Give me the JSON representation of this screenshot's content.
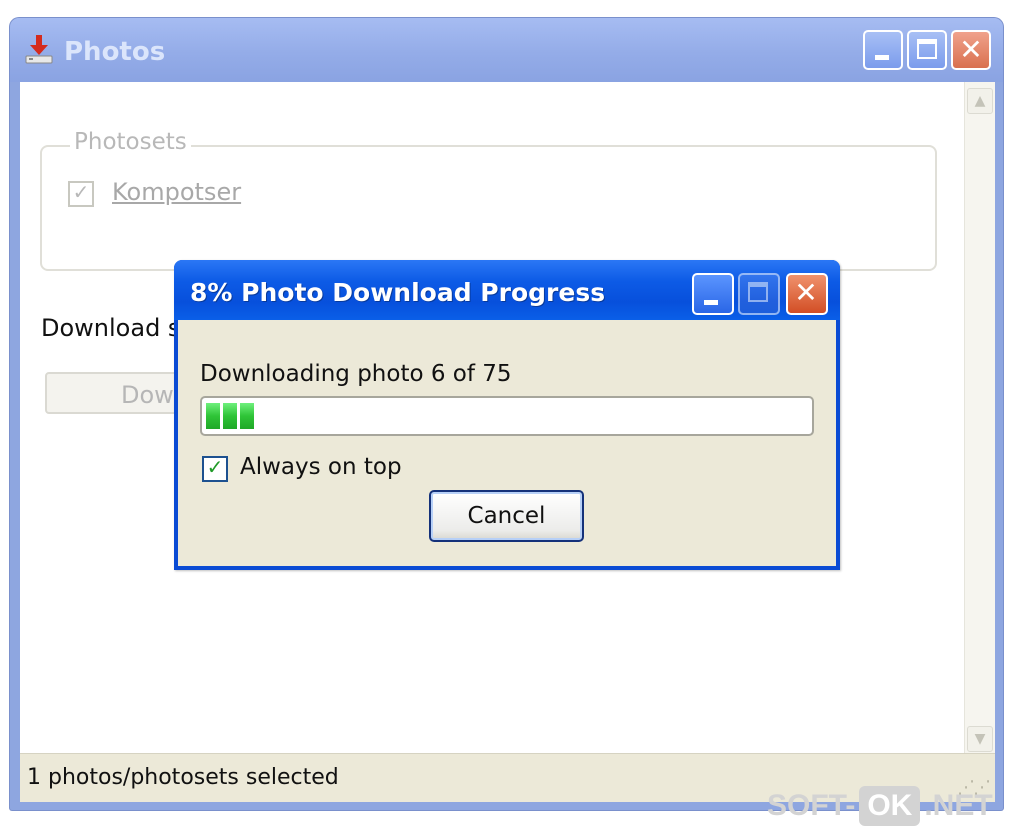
{
  "main_window": {
    "title": "Photos",
    "groupbox_title": "Photosets",
    "photosets": [
      {
        "label": "Kompotser",
        "checked": true
      }
    ],
    "download_label": "Download s",
    "download_button": "Dow",
    "status_text": "1 photos/photosets selected"
  },
  "progress_dialog": {
    "title": "8% Photo Download Progress",
    "status": "Downloading photo 6 of 75",
    "progress_fraction": 0.08,
    "always_on_top_label": "Always on top",
    "always_on_top_checked": true,
    "cancel_label": "Cancel"
  },
  "watermark": {
    "left": "SOFT-",
    "mid": "OK",
    "right": ".NET"
  },
  "colors": {
    "dialog_title_bar": "#0a4bd4",
    "progress_green": "#2fc437",
    "inactive_title_bar": "#94ace8",
    "close_red": "#d24e25"
  },
  "icons": [
    "download-arrow-icon",
    "minimize-icon",
    "maximize-icon",
    "close-icon",
    "checkmark-icon",
    "scroll-up-icon",
    "scroll-down-icon",
    "size-grip-icon"
  ]
}
